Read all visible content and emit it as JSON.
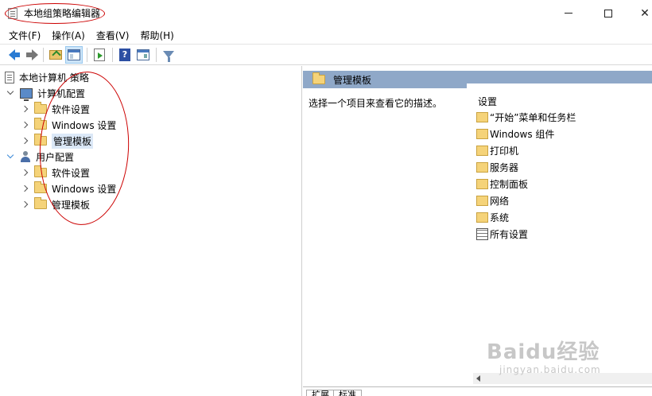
{
  "window": {
    "title": "本地组策略编辑器",
    "controls": {
      "minimize": "",
      "maximize": "",
      "close": "✕"
    }
  },
  "menu": [
    {
      "label": "文件(F)"
    },
    {
      "label": "操作(A)"
    },
    {
      "label": "查看(V)"
    },
    {
      "label": "帮助(H)"
    }
  ],
  "toolbar": {
    "icons": [
      "back-icon",
      "forward-icon",
      "folder-up-icon",
      "show-tree-icon",
      "export-icon",
      "help-icon",
      "properties-icon",
      "filter-icon"
    ],
    "help_glyph": "?"
  },
  "tree": {
    "root": "本地计算机 策略",
    "computer_config": "计算机配置",
    "computer_children": [
      "软件设置",
      "Windows 设置",
      "管理模板"
    ],
    "user_config": "用户配置",
    "user_children": [
      "软件设置",
      "Windows 设置",
      "管理模板"
    ],
    "selected": "管理模板"
  },
  "right": {
    "header": "管理模板",
    "description": "选择一个项目来查看它的描述。",
    "settings_header": "设置",
    "settings": [
      "“开始”菜单和任务栏",
      "Windows 组件",
      "打印机",
      "服务器",
      "控制面板",
      "网络",
      "系统",
      "所有设置"
    ],
    "tabs": [
      "扩展",
      "标准"
    ]
  },
  "watermark": {
    "line1": "Baidu经验",
    "line2": "jingyan.baidu.com"
  },
  "colors": {
    "header_bg": "#8fa8c8",
    "selection": "#dbe8f7",
    "annotation_red": "#cc0000"
  }
}
